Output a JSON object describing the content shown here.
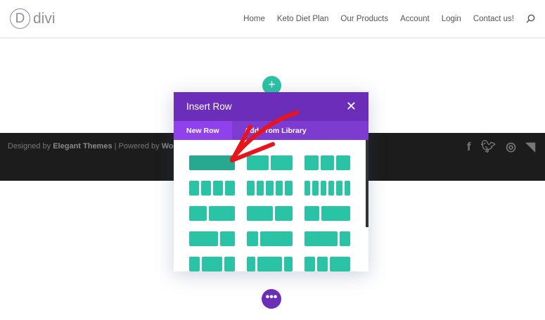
{
  "header": {
    "logo_letter": "D",
    "logo_text": "divi",
    "nav": [
      "Home",
      "Keto Diet Plan",
      "Our Products",
      "Account",
      "Login",
      "Contact us!"
    ]
  },
  "footer": {
    "designed_by": "Designed by",
    "elegant": "Elegant Themes",
    "powered": "| Powered by",
    "wordpress": "WordPress",
    "social": [
      "facebook-icon",
      "twitter-icon",
      "instagram-icon",
      "rss-icon"
    ]
  },
  "modal": {
    "title": "Insert Row",
    "close": "✕",
    "tabs": [
      "New Row",
      "Add From Library"
    ],
    "layouts": [
      [
        1
      ],
      [
        1,
        1
      ],
      [
        1,
        1,
        1
      ],
      [
        1,
        1,
        1,
        1
      ],
      [
        1,
        1,
        1,
        1,
        1
      ],
      [
        1,
        1,
        1,
        1,
        1,
        1
      ],
      [
        2,
        3
      ],
      [
        3,
        2
      ],
      [
        1,
        2
      ],
      [
        2,
        1
      ],
      [
        1,
        3
      ],
      [
        3,
        1
      ],
      [
        1,
        2,
        1
      ],
      [
        1,
        3,
        1
      ],
      [
        1,
        1,
        2
      ]
    ],
    "selected": 0
  },
  "buttons": {
    "plus": "+",
    "dots": "•••"
  },
  "colors": {
    "accent": "#2bc3a5",
    "purple": "#6c2eb9",
    "arrow": "#e8141b"
  }
}
